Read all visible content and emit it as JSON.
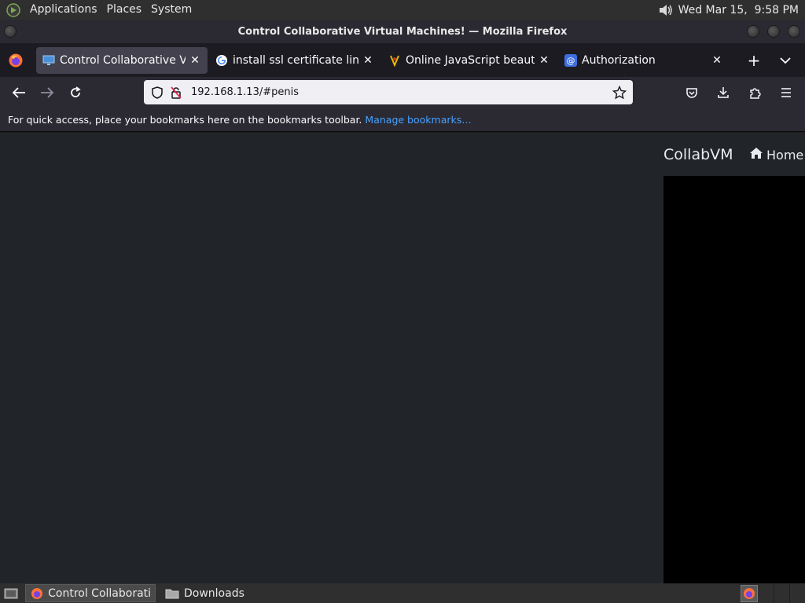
{
  "top_panel": {
    "menus": [
      "Applications",
      "Places",
      "System"
    ],
    "clock": "Wed Mar 15,  9:58 PM"
  },
  "window": {
    "title": "Control Collaborative Virtual Machines! — Mozilla Firefox"
  },
  "tabs": [
    {
      "label": "Control Collaborative Virtual Machines!",
      "favicon": "monitor-icon",
      "active": true
    },
    {
      "label": "install ssl certificate linux - Google Search",
      "favicon": "google-icon",
      "active": false
    },
    {
      "label": "Online JavaScript beautifier",
      "favicon": "beautifier-icon",
      "active": false
    },
    {
      "label": "Authorization",
      "favicon": "at-icon",
      "active": false
    }
  ],
  "navbar": {
    "url": "192.168.1.13/#penis"
  },
  "bookmarks": {
    "message": "For quick access, place your bookmarks here on the bookmarks toolbar.",
    "manage_link": "Manage bookmarks…"
  },
  "page": {
    "brand": "CollabVM",
    "home_label": "Home"
  },
  "taskbar": {
    "tasks": [
      {
        "label": "Control Collaborati…",
        "icon": "firefox-icon",
        "active": true
      },
      {
        "label": "Downloads",
        "icon": "folder-icon",
        "active": false
      }
    ]
  },
  "colors": {
    "content_bg": "#212529",
    "vm_bg": "#000000",
    "link": "#45a1ff"
  }
}
